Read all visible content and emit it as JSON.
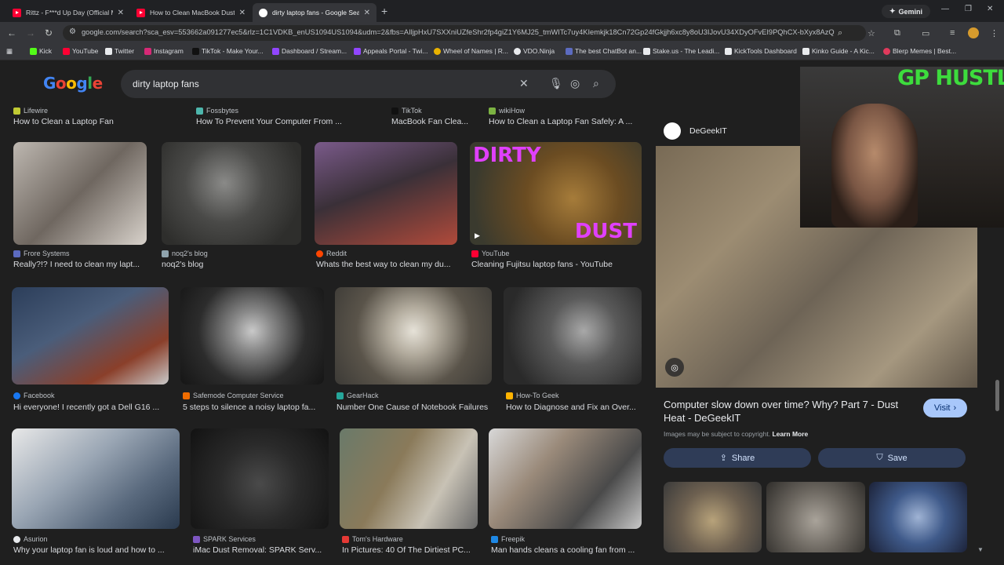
{
  "tabs": [
    {
      "label": "Rittz - F***d Up Day (Official M"
    },
    {
      "label": "How to Clean MacBook Dust &"
    },
    {
      "label": "dirty laptop fans - Google Sear"
    }
  ],
  "gemini_label": "Gemini",
  "url": "google.com/search?sca_esv=553662a091277ec5&rlz=1C1VDKB_enUS1094US1094&udm=2&fbs=AIljpHxU7SXXniUZfeShr2fp4giZ1Y6MJ25_tmWITc7uy4KIemkjk18Cn72Gp24fGkjjh6xc8y8oU3IJovU34XDyOFvEI9PQhCX-bXyx8AzQGU_IURA",
  "bookmarks": [
    "Kick",
    "YouTube",
    "Twitter",
    "Instagram",
    "TikTok - Make Your...",
    "Dashboard / Stream...",
    "Appeals Portal - Twi...",
    "Wheel of Names | R...",
    "VDO.Ninja",
    "The best ChatBot an...",
    "Stake.us - The Leadi...",
    "KickTools Dashboard",
    "Kinko Guide - A Kic...",
    "Blerp Memes | Best..."
  ],
  "google": {
    "logo_text": "Google",
    "query": "dirty laptop fans"
  },
  "results_top": [
    {
      "source": "Lifewire",
      "title": "How to Clean a Laptop Fan"
    },
    {
      "source": "Fossbytes",
      "title": "How To Prevent Your Computer From ..."
    },
    {
      "source": "TikTok",
      "title": "MacBook Fan Clea..."
    },
    {
      "source": "wikiHow",
      "title": "How to Clean a Laptop Fan Safely: A ..."
    }
  ],
  "results_row1": [
    {
      "source": "Frore Systems",
      "title": "Really?!? I need to clean my lapt..."
    },
    {
      "source": "noq2's blog",
      "title": "noq2's blog"
    },
    {
      "source": "Reddit",
      "title": "Whats the best way to clean my du..."
    },
    {
      "source": "YouTube",
      "title": "Cleaning Fujitsu laptop fans - YouTube",
      "overlay_top": "DIRTY",
      "overlay_bottom": "DUST"
    }
  ],
  "results_row2": [
    {
      "source": "Facebook",
      "title": "Hi everyone! I recently got a Dell G16 ..."
    },
    {
      "source": "Safemode Computer Service",
      "title": "5 steps to silence a noisy laptop fa..."
    },
    {
      "source": "GearHack",
      "title": "Number One Cause of Notebook Failures"
    },
    {
      "source": "How-To Geek",
      "title": "How to Diagnose and Fix an Over..."
    }
  ],
  "results_row3": [
    {
      "source": "Asurion",
      "title": "Why your laptop fan is loud and how to ..."
    },
    {
      "source": "SPARK Services",
      "title": "iMac Dust Removal: SPARK Serv..."
    },
    {
      "source": "Tom's Hardware",
      "title": "In Pictures: 40 Of The Dirtiest PC..."
    },
    {
      "source": "Freepik",
      "title": "Man hands cleans a cooling fan from ..."
    }
  ],
  "panel": {
    "site": "DeGeekIT",
    "title": "Computer slow down over time? Why? Part 7 - Dust Heat - DeGeekIT",
    "visit_label": "Visit",
    "copyright_note": "Images may be subject to copyright.",
    "learn_more": "Learn More",
    "share_label": "Share",
    "save_label": "Save"
  },
  "webcam": {
    "overlay_text": "GP HUSTLA"
  },
  "colors": {
    "accent_blue": "#a8c7fa",
    "button_bg": "#2f3c57",
    "page_bg": "#1f1f1f",
    "overlay_green": "#3ddc3d"
  }
}
